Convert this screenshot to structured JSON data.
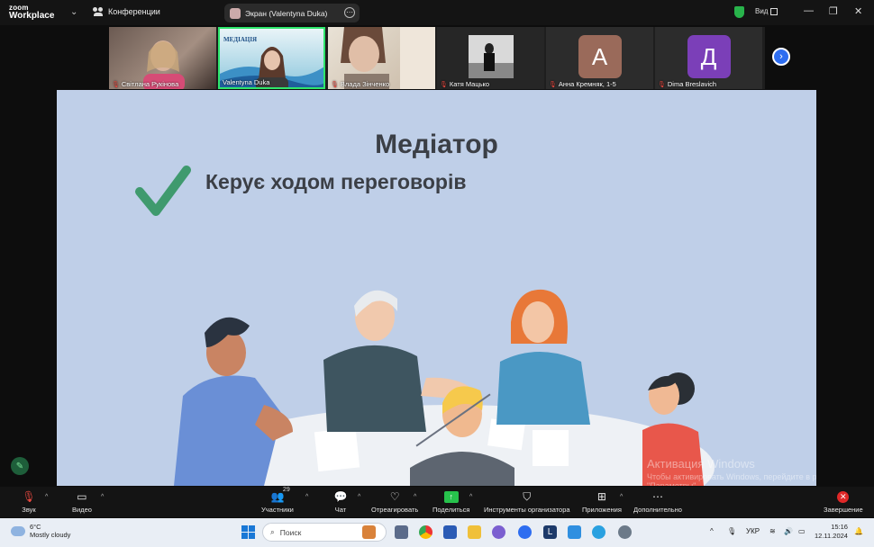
{
  "app": {
    "brand_line1": "zoom",
    "brand_line2": "Workplace",
    "meeting_tab": "Конференции",
    "screen_share_label": "Экран (Valentyna Duka)",
    "view_label": "Вид"
  },
  "gallery": {
    "participants": [
      {
        "name": "Світлана Рукінова",
        "muted": true,
        "kind": "video"
      },
      {
        "name": "Valentyna Duka",
        "muted": false,
        "kind": "video",
        "active": true
      },
      {
        "name": "Влада Зінченко",
        "muted": true,
        "kind": "video"
      },
      {
        "name": "Катя Мацько",
        "muted": true,
        "kind": "photo"
      },
      {
        "name": "Анна Кремняк, 1-5",
        "muted": true,
        "kind": "letter",
        "letter": "А",
        "color": "#9a6a5a"
      },
      {
        "name": "Dima Breslavich",
        "muted": true,
        "kind": "letter",
        "letter": "Д",
        "color": "#7b3fb8"
      }
    ]
  },
  "slide": {
    "title": "Медіатор",
    "point": "Керує ходом переговорів",
    "watermark_title": "Активация Windows",
    "watermark_text": "Чтобы активировать Windows, перейдите в раздел \"Параметры\"."
  },
  "controls": {
    "audio": "Звук",
    "video": "Видео",
    "participants": "Участники",
    "participants_count": "29",
    "chat": "Чат",
    "react": "Отреагировать",
    "share": "Поделиться",
    "host_tools": "Инструменты организатора",
    "apps": "Приложения",
    "more": "Дополнительно",
    "end": "Завершение"
  },
  "taskbar": {
    "weather_temp": "6°C",
    "weather_desc": "Mostly cloudy",
    "search_placeholder": "Поиск",
    "lang": "УКР",
    "time": "15:16",
    "date": "12.11.2024"
  },
  "colors": {
    "slide_bg": "#bfcfe8",
    "check": "#3f9a6e",
    "active_border": "#2fe66c",
    "share_green": "#27c24c",
    "end_red": "#e02828"
  }
}
